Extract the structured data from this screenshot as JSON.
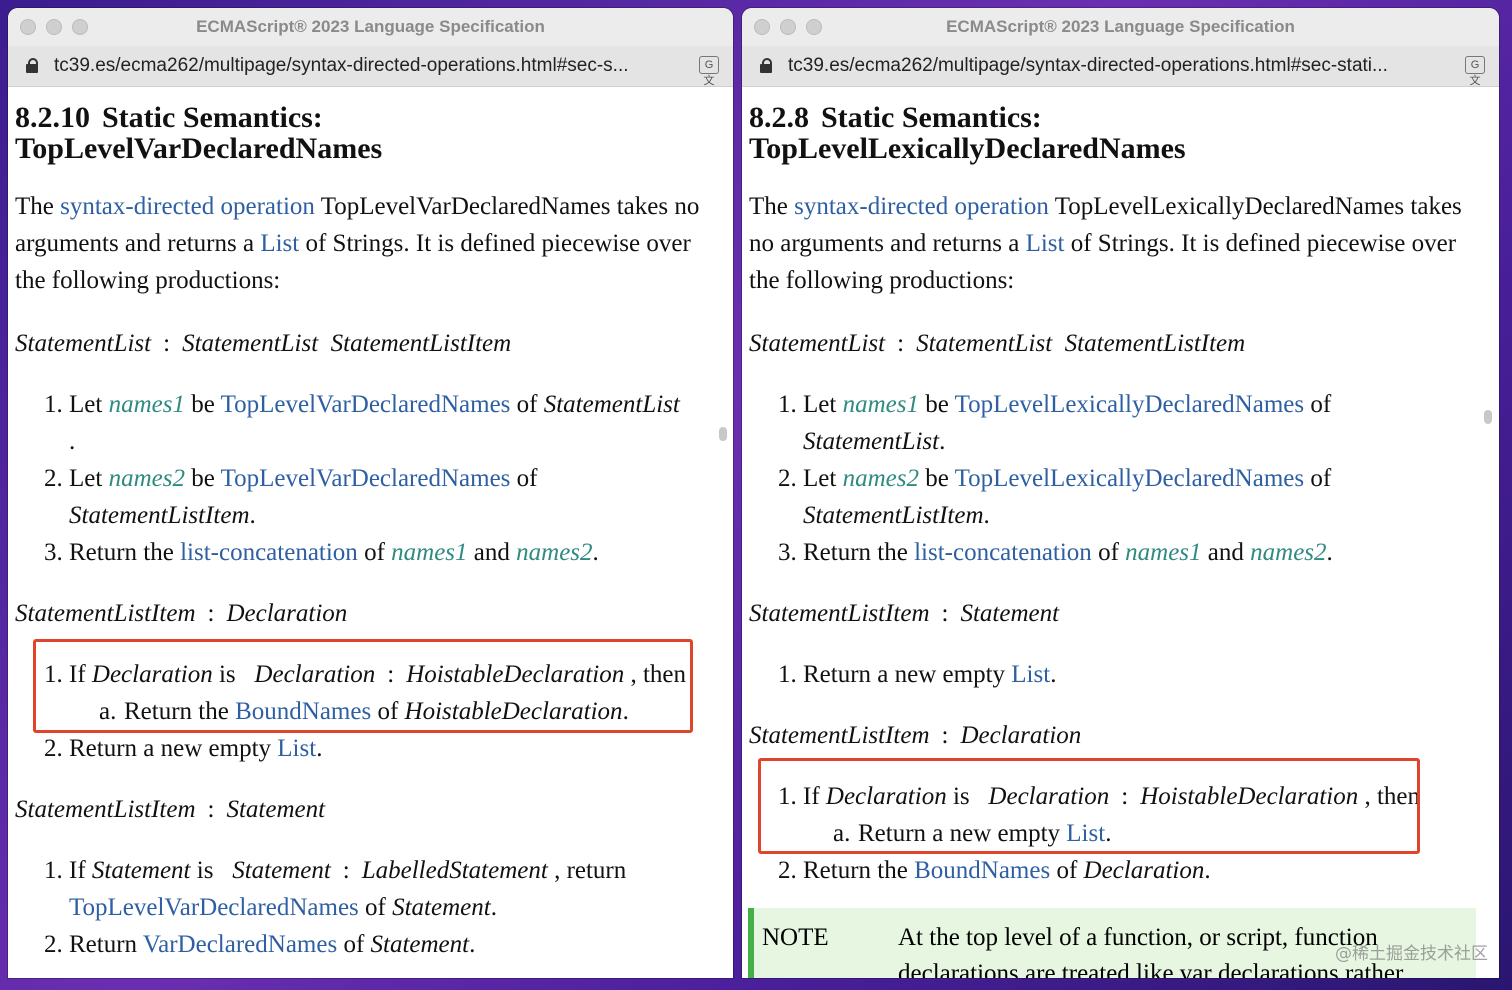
{
  "left": {
    "title": "ECMAScript® 2023 Language Specification",
    "url": "tc39.es/ecma262/multipage/syntax-directed-operations.html#sec-s...",
    "section_number": "8.2.10",
    "section_title_1": "Static Semantics:",
    "section_title_2": "TopLevelVarDeclaredNames",
    "intro": {
      "t1": "The ",
      "link1": "syntax-directed operation",
      "t2": " TopLevelVarDeclaredNames takes no arguments and returns a ",
      "link2": "List",
      "t3": " of Strings. It is defined piecewise over the following productions:"
    },
    "prod1": {
      "lhs": "StatementList",
      "colon": ":",
      "rhs": "StatementList  StatementListItem"
    },
    "alg1": {
      "s1": {
        "num": "1.",
        "t1": "Let ",
        "v1": "names1",
        "t2": " be ",
        "l1": "TopLevelVarDeclaredNames",
        "t3": " of ",
        "nt": "StatementList",
        "t4": "."
      },
      "s2": {
        "num": "2.",
        "t1": "Let ",
        "v1": "names2",
        "t2": " be ",
        "l1": "TopLevelVarDeclaredNames",
        "t3": " of ",
        "nt": "StatementListItem",
        "t4": "."
      },
      "s3": {
        "num": "3.",
        "t1": "Return the ",
        "l1": "list-concatenation",
        "t2": " of ",
        "v1": "names1",
        "t3": " and ",
        "v2": "names2",
        "t4": "."
      }
    },
    "prod2": {
      "lhs": "StatementListItem",
      "colon": ":",
      "rhs": "Declaration"
    },
    "alg2": {
      "s1": {
        "num": "1.",
        "t1": "If ",
        "nt1": "Declaration",
        "t2": " is ",
        "nt2": "Declaration",
        "colon": ":",
        "nt3": "HoistableDeclaration",
        "t3": " , then"
      },
      "s1a": {
        "num": "a.",
        "t1": "Return the ",
        "l1": "BoundNames",
        "t2": " of ",
        "nt": "HoistableDeclaration",
        "t3": "."
      },
      "s2": {
        "num": "2.",
        "t1": "Return a new empty ",
        "l1": "List",
        "t2": "."
      }
    },
    "prod3": {
      "lhs": "StatementListItem",
      "colon": ":",
      "rhs": "Statement"
    },
    "alg3": {
      "s1": {
        "num": "1.",
        "t1": "If ",
        "nt1": "Statement",
        "t2": " is ",
        "nt2": "Statement",
        "colon": ":",
        "nt3": "LabelledStatement",
        "t3": " , return ",
        "l1": "TopLevelVarDeclaredNames",
        "t4": " of ",
        "nt4": "Statement",
        "t5": "."
      },
      "s2": {
        "num": "2.",
        "t1": "Return ",
        "l1": "VarDeclaredNames",
        "t2": " of ",
        "nt": "Statement",
        "t3": "."
      }
    }
  },
  "right": {
    "title": "ECMAScript® 2023 Language Specification",
    "url": "tc39.es/ecma262/multipage/syntax-directed-operations.html#sec-stati...",
    "section_number": "8.2.8",
    "section_title_1": "Static Semantics:",
    "section_title_2": "TopLevelLexicallyDeclaredNames",
    "intro": {
      "t1": "The ",
      "link1": "syntax-directed operation",
      "t2": " TopLevelLexicallyDeclaredNames takes no arguments and returns a ",
      "link2": "List",
      "t3": " of Strings. It is defined piecewise over the following productions:"
    },
    "prod1": {
      "lhs": "StatementList",
      "colon": ":",
      "rhs": "StatementList  StatementListItem"
    },
    "alg1": {
      "s1": {
        "num": "1.",
        "t1": "Let ",
        "v1": "names1",
        "t2": " be ",
        "l1": "TopLevelLexicallyDeclaredNames",
        "t3": " of ",
        "nt": "StatementList",
        "t4": "."
      },
      "s2": {
        "num": "2.",
        "t1": "Let ",
        "v1": "names2",
        "t2": " be ",
        "l1": "TopLevelLexicallyDeclaredNames",
        "t3": " of ",
        "nt": "StatementListItem",
        "t4": "."
      },
      "s3": {
        "num": "3.",
        "t1": "Return the ",
        "l1": "list-concatenation",
        "t2": " of ",
        "v1": "names1",
        "t3": " and ",
        "v2": "names2",
        "t4": "."
      }
    },
    "prod2": {
      "lhs": "StatementListItem",
      "colon": ":",
      "rhs": "Statement"
    },
    "alg2": {
      "s1": {
        "num": "1.",
        "t1": "Return a new empty ",
        "l1": "List",
        "t2": "."
      }
    },
    "prod3": {
      "lhs": "StatementListItem",
      "colon": ":",
      "rhs": "Declaration"
    },
    "alg3": {
      "s1": {
        "num": "1.",
        "t1": "If ",
        "nt1": "Declaration",
        "t2": " is ",
        "nt2": "Declaration",
        "colon": ":",
        "nt3": "HoistableDeclaration",
        "t3": " , then"
      },
      "s1a": {
        "num": "a.",
        "t1": "Return a new empty ",
        "l1": "List",
        "t2": "."
      },
      "s2": {
        "num": "2.",
        "t1": "Return the ",
        "l1": "BoundNames",
        "t2": " of ",
        "nt": "Declaration",
        "t3": "."
      }
    },
    "note": {
      "label": "NOTE",
      "text": "At the top level of a function, or script, function declarations are treated like var declarations rather"
    }
  },
  "watermark": "@稀土掘金技术社区",
  "colors": {
    "link": "#2e5fa3",
    "var": "#2f8a80",
    "highlight_box": "#e0452b",
    "note_bg": "#e6f6e0",
    "note_border": "#44b04a"
  }
}
